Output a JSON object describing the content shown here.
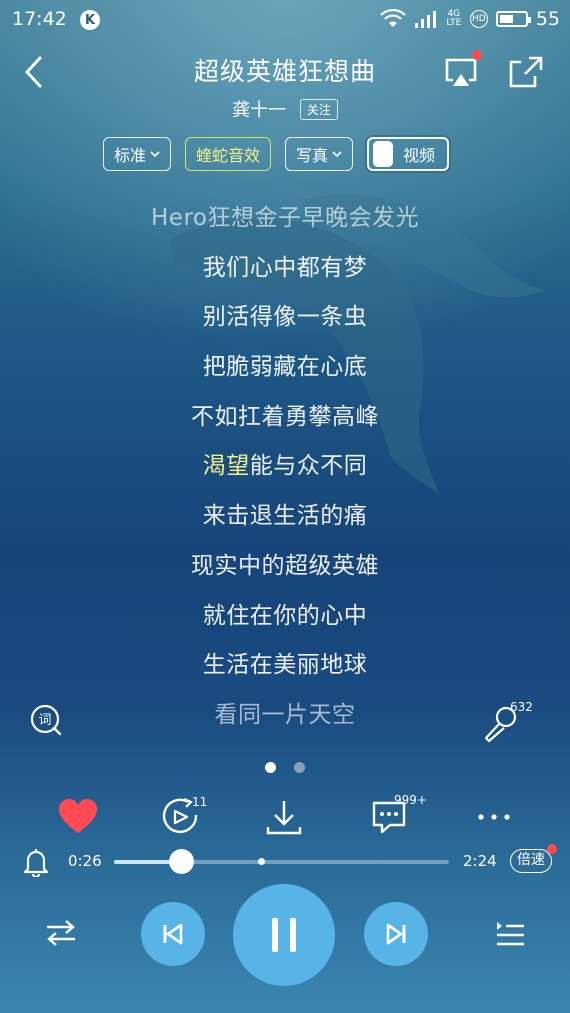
{
  "status_bar": {
    "time": "17:42",
    "app_badge": "K",
    "network_tag": "4G LTE",
    "hd_tag": "HD",
    "battery_level": 0.55,
    "battery_text": "55"
  },
  "header": {
    "song_title": "超级英雄狂想曲",
    "artist": "龚十一",
    "follow_label": "关注"
  },
  "chips": {
    "quality": "标准",
    "effect": "蝰蛇音效",
    "photo": "写真",
    "video": "视频"
  },
  "lyrics": [
    {
      "text": "Hero狂想金子早晚会发光",
      "state": "dim"
    },
    {
      "text": "我们心中都有梦",
      "state": "normal"
    },
    {
      "text": "别活得像一条虫",
      "state": "normal"
    },
    {
      "text": "把脆弱藏在心底",
      "state": "normal"
    },
    {
      "text": "不如扛着勇攀高峰",
      "state": "normal"
    },
    {
      "text": "渴望能与众不同",
      "state": "current",
      "highlight": "渴望"
    },
    {
      "text": "来击退生活的痛",
      "state": "normal"
    },
    {
      "text": "现实中的超级英雄",
      "state": "normal"
    },
    {
      "text": "就住在你的心中",
      "state": "normal"
    },
    {
      "text": "生活在美丽地球",
      "state": "normal"
    },
    {
      "text": "看同一片天空",
      "state": "dim"
    }
  ],
  "lyric_tools": {
    "ci_icon_label": "词",
    "mic_count": "632"
  },
  "pager": {
    "pages": 2,
    "active": 0
  },
  "actions": {
    "comments_ring_count": "11",
    "comment_count": "999+"
  },
  "progress": {
    "current": "0:26",
    "total": "2:24",
    "played_fraction": 0.2,
    "buffered_fraction": 0.43,
    "speed_label": "倍速"
  },
  "colors": {
    "accent": "#58b4e6",
    "highlight": "#f4f08a",
    "like": "#ff4b55",
    "notify_dot": "#ff4b4b"
  }
}
